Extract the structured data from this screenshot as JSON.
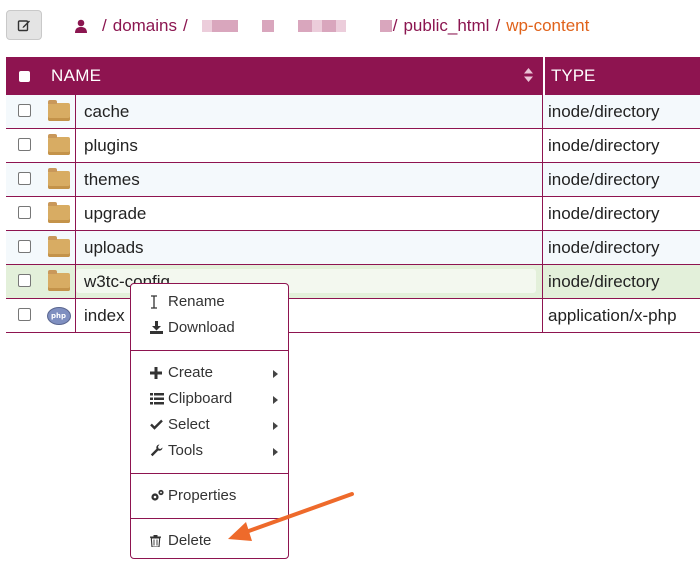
{
  "breadcrumb": {
    "home": "domains",
    "sep": "/",
    "public_html": "public_html",
    "current": "wp-content"
  },
  "table": {
    "headers": {
      "name": "NAME",
      "type": "TYPE"
    },
    "rows": [
      {
        "name": "cache",
        "type": "inode/directory",
        "icon": "folder-icon"
      },
      {
        "name": "plugins",
        "type": "inode/directory",
        "icon": "folder-icon"
      },
      {
        "name": "themes",
        "type": "inode/directory",
        "icon": "folder-icon"
      },
      {
        "name": "upgrade",
        "type": "inode/directory",
        "icon": "folder-icon"
      },
      {
        "name": "uploads",
        "type": "inode/directory",
        "icon": "folder-icon"
      },
      {
        "name": "w3tc-config",
        "type": "inode/directory",
        "icon": "folder-icon"
      },
      {
        "name": "index",
        "type": "application/x-php",
        "icon": "php-file-icon",
        "icon_text": "php"
      }
    ]
  },
  "context_menu": {
    "rename": "Rename",
    "download": "Download",
    "create": "Create",
    "clipboard": "Clipboard",
    "select": "Select",
    "tools": "Tools",
    "properties": "Properties",
    "delete": "Delete"
  },
  "colors": {
    "header_bg": "#8e1450",
    "link": "#8b1650",
    "current": "#e0621a",
    "arrow": "#ee6a2b"
  }
}
